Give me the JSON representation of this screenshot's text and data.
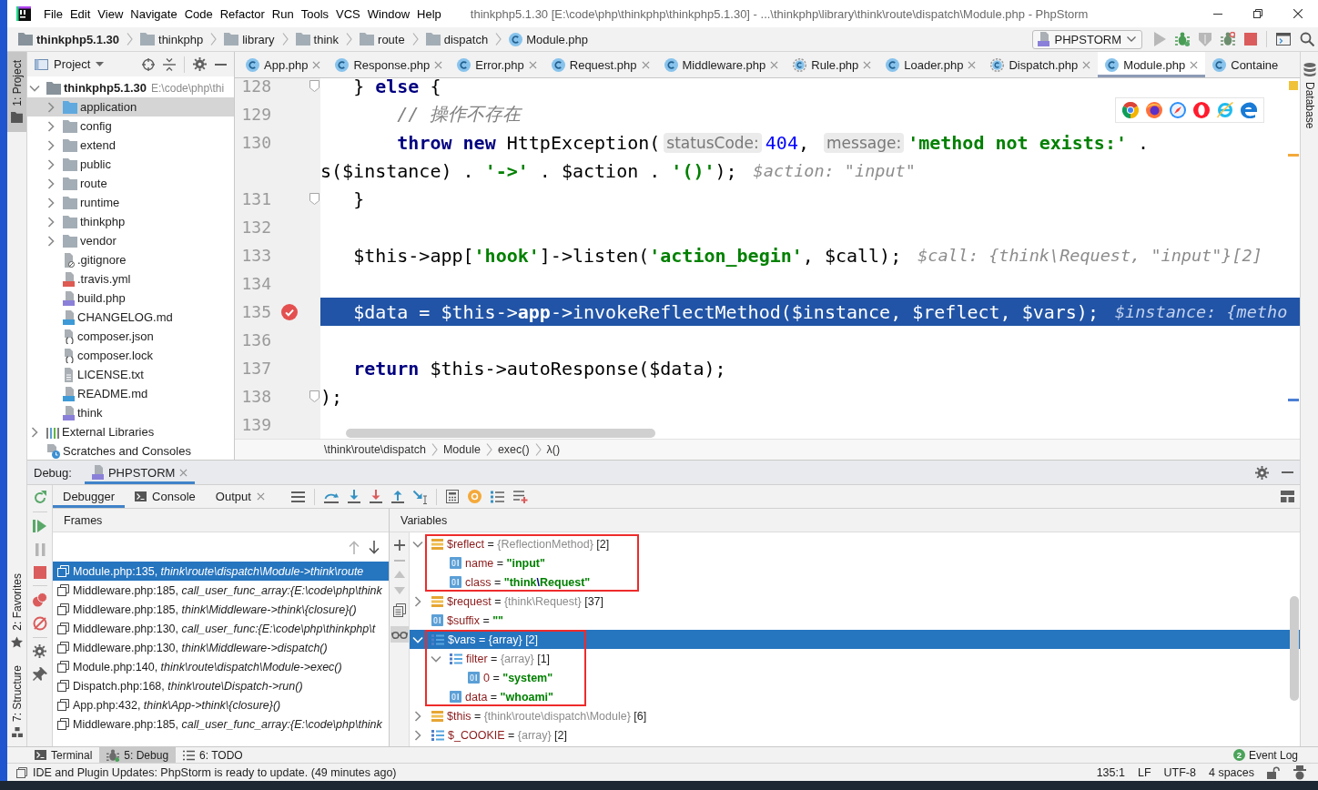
{
  "window": {
    "title": "thinkphp5.1.30 [E:\\code\\php\\thinkphp\\thinkphp5.1.30] - ...\\thinkphp\\library\\think\\route\\dispatch\\Module.php - PhpStorm"
  },
  "menu": [
    "File",
    "Edit",
    "View",
    "Navigate",
    "Code",
    "Refactor",
    "Run",
    "Tools",
    "VCS",
    "Window",
    "Help"
  ],
  "navigation_bar": {
    "breadcrumbs": [
      {
        "label": "thinkphp5.1.30",
        "kind": "project"
      },
      {
        "label": "thinkphp",
        "kind": "folder"
      },
      {
        "label": "library",
        "kind": "folder"
      },
      {
        "label": "think",
        "kind": "folder"
      },
      {
        "label": "route",
        "kind": "folder"
      },
      {
        "label": "dispatch",
        "kind": "folder"
      },
      {
        "label": "Module.php",
        "kind": "class"
      }
    ],
    "run_configuration": "PHPSTORM"
  },
  "left_tool_tabs": [
    {
      "label": "1: Project",
      "selected": true,
      "kind": "project"
    },
    {
      "label": "2: Favorites",
      "selected": false,
      "kind": "favorites"
    },
    {
      "label": "7: Structure",
      "selected": false,
      "kind": "structure"
    }
  ],
  "right_tool_tabs": [
    {
      "label": "Database",
      "selected": false
    }
  ],
  "project": {
    "title": "Project",
    "tree": [
      {
        "label": "thinkphp5.1.30",
        "path": "E:\\code\\php\\thi",
        "kind": "root",
        "expanded": true,
        "selected": false,
        "children": [
          {
            "label": "application",
            "kind": "source",
            "expanded": false,
            "selected": true
          },
          {
            "label": "config",
            "kind": "folder",
            "expanded": false,
            "selected": false
          },
          {
            "label": "extend",
            "kind": "folder",
            "expanded": false,
            "selected": false
          },
          {
            "label": "public",
            "kind": "folder",
            "expanded": false,
            "selected": false
          },
          {
            "label": "route",
            "kind": "folder",
            "expanded": false,
            "selected": false
          },
          {
            "label": "runtime",
            "kind": "folder",
            "expanded": false,
            "selected": false
          },
          {
            "label": "thinkphp",
            "kind": "folder",
            "expanded": false,
            "selected": false
          },
          {
            "label": "vendor",
            "kind": "folder",
            "expanded": false,
            "selected": false
          },
          {
            "label": ".gitignore",
            "kind": "ignore",
            "selected": false
          },
          {
            "label": ".travis.yml",
            "kind": "yml",
            "selected": false
          },
          {
            "label": "build.php",
            "kind": "php",
            "selected": false
          },
          {
            "label": "CHANGELOG.md",
            "kind": "markdown",
            "selected": false
          },
          {
            "label": "composer.json",
            "kind": "json",
            "selected": false
          },
          {
            "label": "composer.lock",
            "kind": "json",
            "selected": false
          },
          {
            "label": "LICENSE.txt",
            "kind": "text",
            "selected": false
          },
          {
            "label": "README.md",
            "kind": "markdown",
            "selected": false
          },
          {
            "label": "think",
            "kind": "php",
            "selected": false
          }
        ]
      },
      {
        "label": "External Libraries",
        "kind": "library",
        "expanded": false,
        "selected": false
      },
      {
        "label": "Scratches and Consoles",
        "kind": "scratch",
        "selected": false
      }
    ]
  },
  "editor": {
    "tabs": [
      {
        "label": "App.php",
        "kind": "class",
        "selected": false,
        "closable": true
      },
      {
        "label": "Response.php",
        "kind": "class",
        "selected": false,
        "closable": true
      },
      {
        "label": "Error.php",
        "kind": "class",
        "selected": false,
        "closable": true
      },
      {
        "label": "Request.php",
        "kind": "class",
        "selected": false,
        "closable": true
      },
      {
        "label": "Middleware.php",
        "kind": "class",
        "selected": false,
        "closable": true
      },
      {
        "label": "Rule.php",
        "kind": "abstract",
        "selected": false,
        "closable": true
      },
      {
        "label": "Loader.php",
        "kind": "class",
        "selected": false,
        "closable": true
      },
      {
        "label": "Dispatch.php",
        "kind": "abstract",
        "selected": false,
        "closable": true
      },
      {
        "label": "Module.php",
        "kind": "class",
        "selected": true,
        "closable": true
      },
      {
        "label": "Containe",
        "kind": "class",
        "selected": false,
        "closable": false
      }
    ],
    "lines": [
      {
        "number": "128",
        "fold": true,
        "breakpoint": false,
        "current": false,
        "segments": [
          {
            "kind": "code",
            "tokens": [
              {
                "text": "   } ",
                "kind": "plain"
              },
              {
                "text": "else",
                "kind": "keyword"
              },
              {
                "text": " {",
                "kind": "plain"
              }
            ]
          }
        ]
      },
      {
        "number": "129",
        "fold": false,
        "breakpoint": false,
        "current": false,
        "segments": [
          {
            "kind": "code",
            "tokens": [
              {
                "text": "       // 操作不存在",
                "kind": "comment"
              }
            ]
          }
        ]
      },
      {
        "number": "130",
        "fold": false,
        "breakpoint": false,
        "current": false,
        "segments": [
          {
            "kind": "code",
            "tokens": [
              {
                "text": "       throw new",
                "kind": "keyword"
              },
              {
                "text": " HttpException(",
                "kind": "plain"
              }
            ]
          },
          {
            "kind": "hint",
            "text": "statusCode:"
          },
          {
            "kind": "code",
            "tokens": [
              {
                "text": "404",
                "kind": "number"
              },
              {
                "text": ", ",
                "kind": "plain"
              }
            ]
          },
          {
            "kind": "hint",
            "text": "message:"
          },
          {
            "kind": "code",
            "tokens": [
              {
                "text": "'method not exists:'",
                "kind": "string"
              },
              {
                "text": " .",
                "kind": "plain"
              }
            ]
          }
        ],
        "wrap": [
          {
            "kind": "code",
            "tokens": [
              {
                "text": "s($instance) . ",
                "kind": "plain"
              },
              {
                "text": "'->'",
                "kind": "string"
              },
              {
                "text": " . $action . ",
                "kind": "plain"
              },
              {
                "text": "'()'",
                "kind": "string"
              },
              {
                "text": ");",
                "kind": "plain"
              }
            ]
          },
          {
            "kind": "value",
            "text": "$action: \"input\""
          }
        ]
      },
      {
        "number": "131",
        "fold": true,
        "breakpoint": false,
        "current": false,
        "segments": [
          {
            "kind": "code",
            "tokens": [
              {
                "text": "   }",
                "kind": "plain"
              }
            ]
          }
        ]
      },
      {
        "number": "132",
        "fold": false,
        "breakpoint": false,
        "current": false
      },
      {
        "number": "133",
        "fold": false,
        "breakpoint": false,
        "current": false,
        "segments": [
          {
            "kind": "code",
            "tokens": [
              {
                "text": "   $this->app[",
                "kind": "plain"
              },
              {
                "text": "'hook'",
                "kind": "string"
              },
              {
                "text": "]->listen(",
                "kind": "plain"
              },
              {
                "text": "'action_begin'",
                "kind": "string"
              },
              {
                "text": ", $call);",
                "kind": "plain"
              }
            ]
          },
          {
            "kind": "value",
            "text": "$call: {think\\Request, \"input\"}[2]"
          }
        ]
      },
      {
        "number": "134",
        "fold": false,
        "breakpoint": false,
        "current": false
      },
      {
        "number": "135",
        "fold": false,
        "breakpoint": true,
        "current": true,
        "segments": [
          {
            "kind": "code",
            "tokens": [
              {
                "text": "   $data = $this->",
                "kind": "plain"
              },
              {
                "text": "app",
                "kind": "bold"
              },
              {
                "text": "->invokeReflectMethod($instance, $reflect, $vars);",
                "kind": "plain"
              }
            ]
          },
          {
            "kind": "value",
            "text": "$instance: {metho"
          }
        ]
      },
      {
        "number": "136",
        "fold": false,
        "breakpoint": false,
        "current": false
      },
      {
        "number": "137",
        "fold": false,
        "breakpoint": false,
        "current": false,
        "segments": [
          {
            "kind": "code",
            "tokens": [
              {
                "text": "   return",
                "kind": "keyword"
              },
              {
                "text": " $this->autoResponse($data);",
                "kind": "plain"
              }
            ]
          }
        ]
      },
      {
        "number": "138",
        "fold": true,
        "breakpoint": false,
        "current": false,
        "segments": [
          {
            "kind": "code",
            "tokens": [
              {
                "text": ");",
                "kind": "plain"
              }
            ]
          }
        ]
      },
      {
        "number": "139",
        "fold": false,
        "breakpoint": false,
        "current": false
      }
    ],
    "breadcrumbs": [
      "\\think\\route\\dispatch",
      "Module",
      "exec()",
      "λ()"
    ]
  },
  "debug": {
    "title": "Debug:",
    "sessions": [
      {
        "label": "PHPSTORM",
        "selected": true
      }
    ],
    "tabs": [
      {
        "label": "Debugger",
        "kind": "debugger",
        "selected": true,
        "closable": false
      },
      {
        "label": "Console",
        "kind": "console",
        "selected": false,
        "closable": false
      },
      {
        "label": "Output",
        "kind": "output",
        "selected": false,
        "closable": true
      }
    ],
    "frames": {
      "title": "Frames",
      "items": [
        {
          "text": "Module.php:135, *think\\route\\dispatch\\Module->think\\route*",
          "selected": true
        },
        {
          "text": "Middleware.php:185, *call_user_func_array:{E:\\code\\php\\think*",
          "selected": false
        },
        {
          "text": "Middleware.php:185, *think\\Middleware->think\\{closure}()*",
          "selected": false
        },
        {
          "text": "Middleware.php:130, *call_user_func:{E:\\code\\php\\thinkphp\\t*",
          "selected": false
        },
        {
          "text": "Middleware.php:130, *think\\Middleware->dispatch()*",
          "selected": false
        },
        {
          "text": "Module.php:140, *think\\route\\dispatch\\Module->exec()*",
          "selected": false
        },
        {
          "text": "Dispatch.php:168, *think\\route\\Dispatch->run()*",
          "selected": false
        },
        {
          "text": "App.php:432, *think\\App->think\\{closure}()*",
          "selected": false
        },
        {
          "text": "Middleware.php:185, *call_user_func_array:{E:\\code\\php\\think*",
          "selected": false
        }
      ]
    },
    "variables": {
      "title": "Variables",
      "tree": [
        {
          "kind": "object",
          "expanded": true,
          "selected": false,
          "annotated": true,
          "tokens": [
            {
              "text": "$reflect",
              "kind": "name"
            },
            {
              "text": " = ",
              "kind": "plain"
            },
            {
              "text": "{ReflectionMethod}",
              "kind": "type"
            },
            {
              "text": " [2]",
              "kind": "plain"
            }
          ],
          "children": [
            {
              "kind": "primitive",
              "selected": false,
              "tokens": [
                {
                  "text": "name",
                  "kind": "name"
                },
                {
                  "text": " = ",
                  "kind": "plain"
                },
                {
                  "text": "\"input\"",
                  "kind": "string"
                }
              ]
            },
            {
              "kind": "primitive",
              "selected": false,
              "tokens": [
                {
                  "text": "class",
                  "kind": "name"
                },
                {
                  "text": " = ",
                  "kind": "plain"
                },
                {
                  "text": "\"think",
                  "kind": "string"
                },
                {
                  "text": "\\",
                  "kind": "escape"
                },
                {
                  "text": "Request\"",
                  "kind": "string"
                }
              ]
            }
          ]
        },
        {
          "kind": "object",
          "expanded": false,
          "selected": false,
          "annotated": false,
          "tokens": [
            {
              "text": "$request",
              "kind": "name"
            },
            {
              "text": " = ",
              "kind": "plain"
            },
            {
              "text": "{think\\Request}",
              "kind": "type"
            },
            {
              "text": " [37]",
              "kind": "plain"
            }
          ]
        },
        {
          "kind": "primitive",
          "selected": false,
          "annotated": false,
          "tokens": [
            {
              "text": "$suffix",
              "kind": "name"
            },
            {
              "text": " = ",
              "kind": "plain"
            },
            {
              "text": "\"\"",
              "kind": "string"
            }
          ]
        },
        {
          "kind": "array",
          "expanded": true,
          "selected": true,
          "annotated": true,
          "tokens": [
            {
              "text": "$vars",
              "kind": "name"
            },
            {
              "text": " = ",
              "kind": "plain"
            },
            {
              "text": "{array}",
              "kind": "type"
            },
            {
              "text": " [2]",
              "kind": "plain"
            }
          ],
          "children": [
            {
              "kind": "array",
              "expanded": true,
              "selected": false,
              "tokens": [
                {
                  "text": "filter",
                  "kind": "name"
                },
                {
                  "text": " = ",
                  "kind": "plain"
                },
                {
                  "text": "{array}",
                  "kind": "type"
                },
                {
                  "text": " [1]",
                  "kind": "plain"
                }
              ],
              "children": [
                {
                  "kind": "primitive",
                  "selected": false,
                  "tokens": [
                    {
                      "text": "0",
                      "kind": "name"
                    },
                    {
                      "text": " = ",
                      "kind": "plain"
                    },
                    {
                      "text": "\"system\"",
                      "kind": "string"
                    }
                  ]
                }
              ]
            },
            {
              "kind": "primitive",
              "selected": false,
              "tokens": [
                {
                  "text": "data",
                  "kind": "name"
                },
                {
                  "text": " = ",
                  "kind": "plain"
                },
                {
                  "text": "\"whoami\"",
                  "kind": "string"
                }
              ]
            }
          ]
        },
        {
          "kind": "object",
          "expanded": false,
          "selected": false,
          "annotated": false,
          "tokens": [
            {
              "text": "$this",
              "kind": "name"
            },
            {
              "text": " = ",
              "kind": "plain"
            },
            {
              "text": "{think\\route\\dispatch\\Module}",
              "kind": "type"
            },
            {
              "text": " [6]",
              "kind": "plain"
            }
          ]
        },
        {
          "kind": "array",
          "expanded": false,
          "selected": false,
          "annotated": false,
          "tokens": [
            {
              "text": "$_COOKIE",
              "kind": "name"
            },
            {
              "text": " = ",
              "kind": "plain"
            },
            {
              "text": "{array}",
              "kind": "type"
            },
            {
              "text": " [2]",
              "kind": "plain"
            }
          ]
        }
      ]
    }
  },
  "bottom_tool_tabs": [
    {
      "label": "Terminal",
      "kind": "terminal",
      "selected": false
    },
    {
      "label": "5: Debug",
      "kind": "debug",
      "selected": true
    },
    {
      "label": "6: TODO",
      "kind": "todo",
      "selected": false
    }
  ],
  "event_log": {
    "label": "Event Log",
    "count": "2"
  },
  "status_bar": {
    "message": "IDE and Plugin Updates: PhpStorm is ready to update. (49 minutes ago)",
    "items": [
      "135:1",
      "LF",
      "UTF-8",
      "4 spaces"
    ]
  }
}
